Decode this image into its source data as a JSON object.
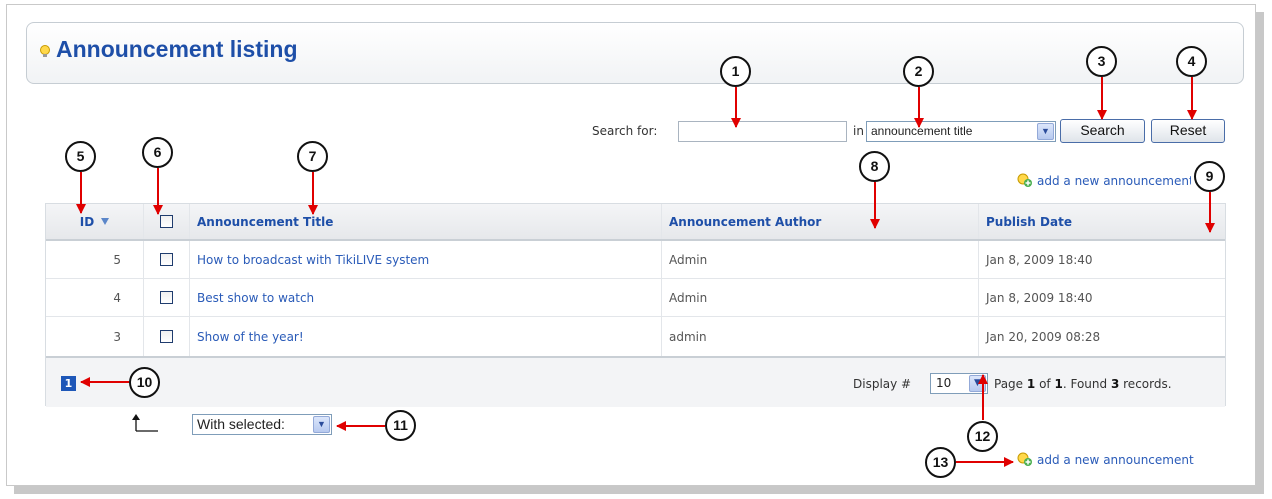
{
  "header": {
    "title": "Announcement listing"
  },
  "search": {
    "label": "Search for:",
    "value": "",
    "in_label": "in",
    "field_selected": "announcement title",
    "search_button": "Search",
    "reset_button": "Reset"
  },
  "add_link_top": "add a new announcement",
  "add_link_bottom": "add a new announcement",
  "table": {
    "columns": {
      "id": "ID",
      "title": "Announcement Title",
      "author": "Announcement Author",
      "date": "Publish Date"
    },
    "rows": [
      {
        "id": "5",
        "title": "How to broadcast with TikiLIVE system",
        "author": "Admin",
        "date": "Jan 8, 2009 18:40"
      },
      {
        "id": "4",
        "title": "Best show to watch",
        "author": "Admin",
        "date": "Jan 8, 2009 18:40"
      },
      {
        "id": "3",
        "title": "Show of the year!",
        "author": "admin",
        "date": "Jan 20, 2009 08:28"
      }
    ]
  },
  "pager": {
    "current_page": "1",
    "display_label": "Display #",
    "display_value": "10",
    "page_prefix": "Page",
    "page_num": "1",
    "page_of": "of",
    "page_total": "1",
    "found_prefix": ". Found",
    "record_count": "3",
    "found_suffix": "records."
  },
  "bulk": {
    "with_selected": "With selected:"
  },
  "callouts": [
    "1",
    "2",
    "3",
    "4",
    "5",
    "6",
    "7",
    "8",
    "9",
    "10",
    "11",
    "12",
    "13"
  ],
  "colors": {
    "title_blue": "#1e4fa8",
    "link_blue": "#2a5bb8",
    "arrow_red": "#e00000",
    "page_current": "#1e57b8"
  }
}
